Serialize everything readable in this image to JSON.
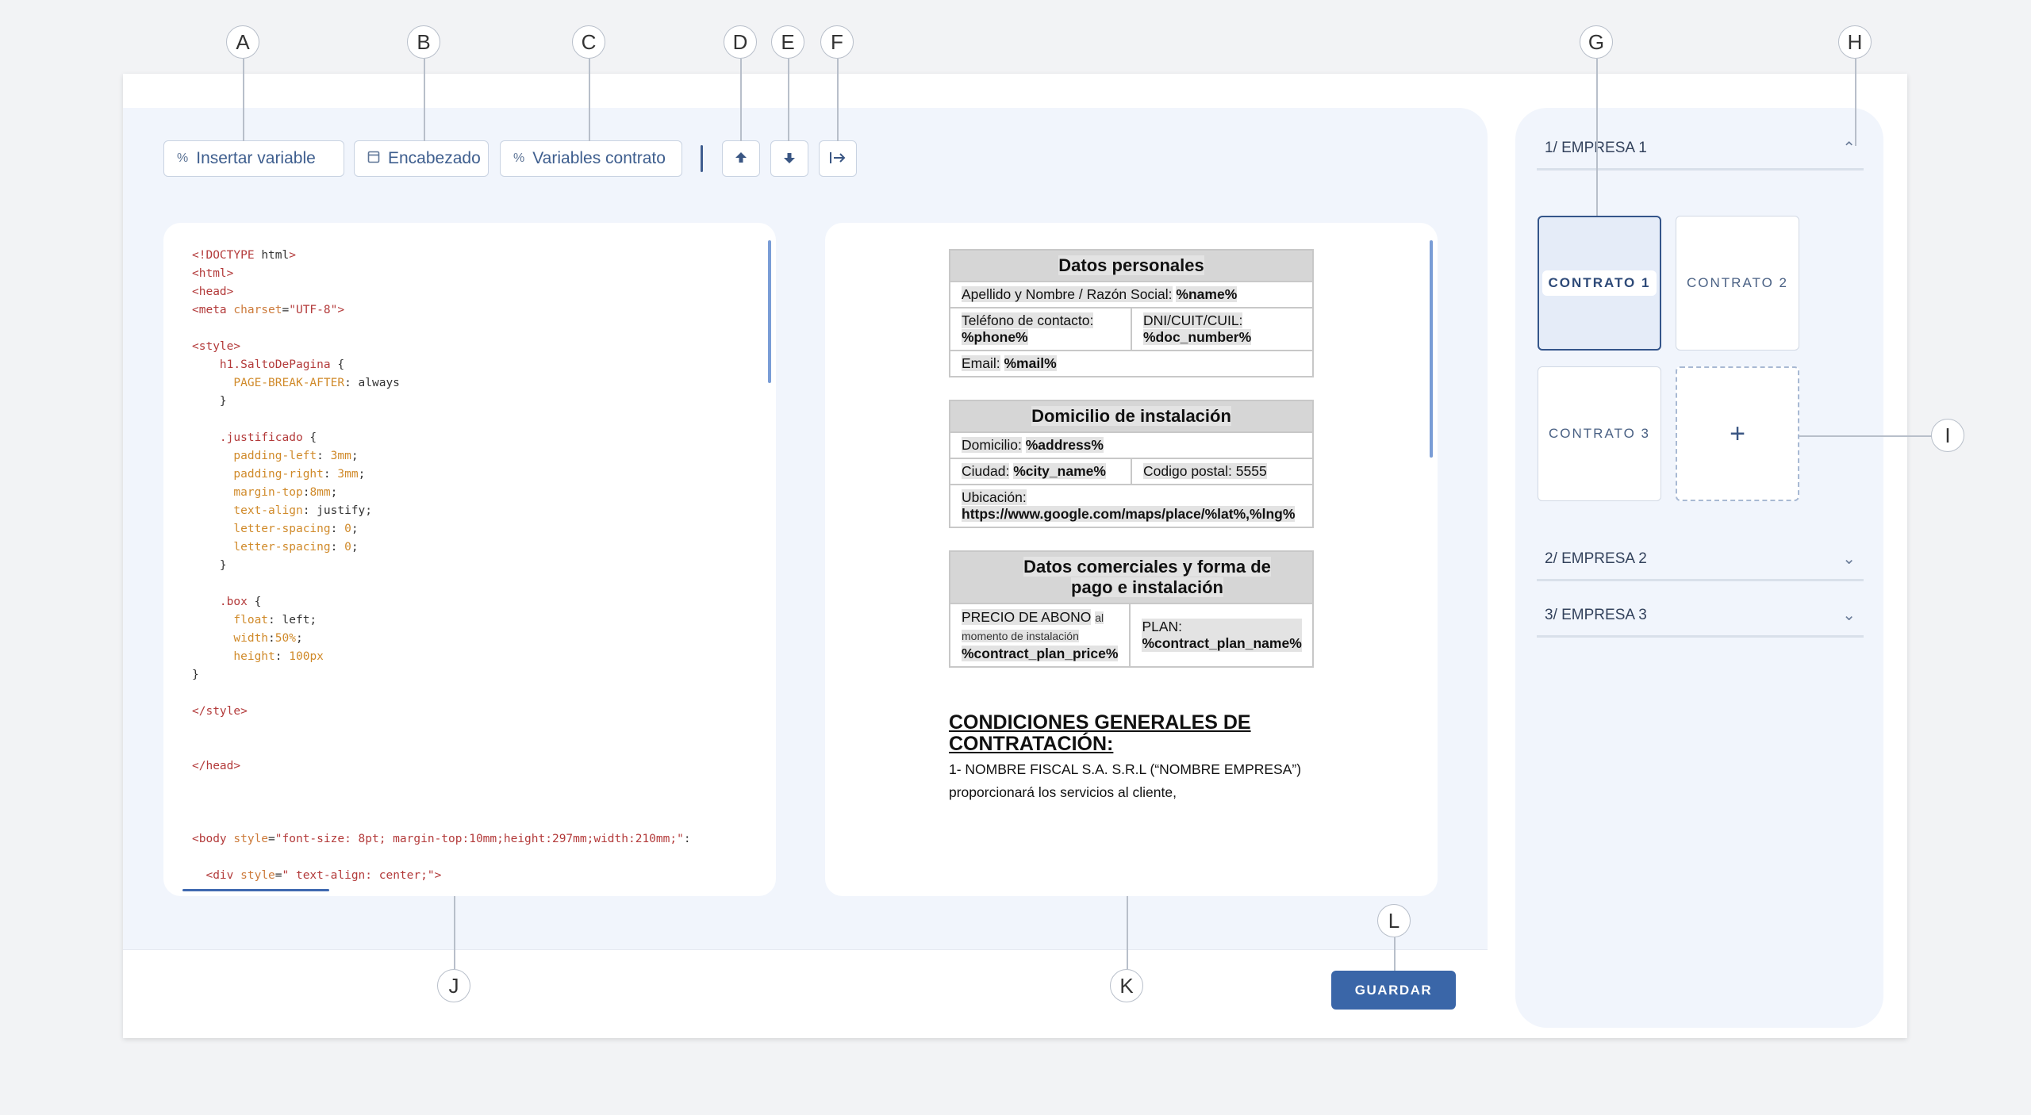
{
  "toolbar": {
    "insert_variable": "Insertar variable",
    "header": "Encabezado",
    "contract_variables": "Variables contrato"
  },
  "callouts": [
    "A",
    "B",
    "C",
    "D",
    "E",
    "F",
    "G",
    "H",
    "I",
    "J",
    "K",
    "L"
  ],
  "code": [
    [
      [
        "t-red",
        "<!DOCTYPE "
      ],
      [
        "t-dk",
        "html"
      ],
      [
        "t-red",
        ">"
      ]
    ],
    [
      [
        "t-red",
        "<html>"
      ]
    ],
    [
      [
        "t-red",
        "<head>"
      ]
    ],
    [
      [
        "t-red",
        "<meta "
      ],
      [
        "t-org",
        "charset"
      ],
      [
        "t-dk",
        "="
      ],
      [
        "t-str",
        "\"UTF-8\""
      ],
      [
        "t-red",
        ">"
      ]
    ],
    [],
    [
      [
        "t-red",
        "<style>"
      ]
    ],
    [
      [
        "t-dk",
        "    "
      ],
      [
        "t-red",
        "h1."
      ],
      [
        "t-red",
        "SaltoDePagina"
      ],
      [
        "t-dk",
        " {"
      ]
    ],
    [
      [
        "t-dk",
        "      "
      ],
      [
        "t-ylw",
        "PAGE-BREAK-AFTER"
      ],
      [
        "t-dk",
        ": always"
      ]
    ],
    [
      [
        "t-dk",
        "    }"
      ]
    ],
    [],
    [
      [
        "t-dk",
        "    "
      ],
      [
        "t-red",
        ".justificado"
      ],
      [
        "t-dk",
        " {"
      ]
    ],
    [
      [
        "t-dk",
        "      "
      ],
      [
        "t-ylw",
        "padding-left"
      ],
      [
        "t-dk",
        ": "
      ],
      [
        "t-ylw",
        "3mm"
      ],
      [
        "t-dk",
        ";"
      ]
    ],
    [
      [
        "t-dk",
        "      "
      ],
      [
        "t-ylw",
        "padding-right"
      ],
      [
        "t-dk",
        ": "
      ],
      [
        "t-ylw",
        "3mm"
      ],
      [
        "t-dk",
        ";"
      ]
    ],
    [
      [
        "t-dk",
        "      "
      ],
      [
        "t-ylw",
        "margin-top"
      ],
      [
        "t-dk",
        ":"
      ],
      [
        "t-ylw",
        "8mm"
      ],
      [
        "t-dk",
        ";"
      ]
    ],
    [
      [
        "t-dk",
        "      "
      ],
      [
        "t-ylw",
        "text-align"
      ],
      [
        "t-dk",
        ": justify;"
      ]
    ],
    [
      [
        "t-dk",
        "      "
      ],
      [
        "t-ylw",
        "letter-spacing"
      ],
      [
        "t-dk",
        ": "
      ],
      [
        "t-ylw",
        "0"
      ],
      [
        "t-dk",
        ";"
      ]
    ],
    [
      [
        "t-dk",
        "      "
      ],
      [
        "t-ylw",
        "letter-spacing"
      ],
      [
        "t-dk",
        ": "
      ],
      [
        "t-ylw",
        "0"
      ],
      [
        "t-dk",
        ";"
      ]
    ],
    [
      [
        "t-dk",
        "    }"
      ]
    ],
    [],
    [
      [
        "t-dk",
        "    "
      ],
      [
        "t-red",
        ".box"
      ],
      [
        "t-dk",
        " {"
      ]
    ],
    [
      [
        "t-dk",
        "      "
      ],
      [
        "t-ylw",
        "float"
      ],
      [
        "t-dk",
        ": left;"
      ]
    ],
    [
      [
        "t-dk",
        "      "
      ],
      [
        "t-ylw",
        "width"
      ],
      [
        "t-dk",
        ":"
      ],
      [
        "t-ylw",
        "50%"
      ],
      [
        "t-dk",
        ";"
      ]
    ],
    [
      [
        "t-dk",
        "      "
      ],
      [
        "t-ylw",
        "height"
      ],
      [
        "t-dk",
        ": "
      ],
      [
        "t-ylw",
        "100px"
      ]
    ],
    [
      [
        "t-dk",
        "}"
      ]
    ],
    [],
    [
      [
        "t-red",
        "</style>"
      ]
    ],
    [],
    [],
    [
      [
        "t-red",
        "</head>"
      ]
    ],
    [],
    [],
    [],
    [
      [
        "t-red",
        "<body "
      ],
      [
        "t-org",
        "style"
      ],
      [
        "t-dk",
        "="
      ],
      [
        "t-str",
        "\"font-size: 8pt; margin-top:10mm;height:297mm;width:210mm;\""
      ],
      [
        "t-dk",
        ":"
      ]
    ],
    [],
    [
      [
        "t-dk",
        "  "
      ],
      [
        "t-red",
        "<div "
      ],
      [
        "t-org",
        "style"
      ],
      [
        "t-dk",
        "="
      ],
      [
        "t-str",
        "\" text-align: center;\""
      ],
      [
        "t-red",
        ">"
      ]
    ]
  ],
  "preview": {
    "personal": {
      "title": "Datos personales",
      "name_label": "Apellido y Nombre / Razón Social:",
      "name_var": "%name%",
      "phone_label": "Teléfono de contacto:",
      "phone_var": "%phone%",
      "doc_label": "DNI/CUIT/CUIL:",
      "doc_var": "%doc_number%",
      "mail_label": "Email:",
      "mail_var": "%mail%"
    },
    "install": {
      "title": "Domicilio de instalación",
      "address_label": "Domicilio:",
      "address_var": "%address%",
      "city_label": "Ciudad:",
      "city_var": "%city_name%",
      "postal": "Codigo postal: 5555",
      "location_label": "Ubicación:",
      "location_var": "https://www.google.com/maps/place/%lat%,%lng%"
    },
    "commercial": {
      "title": "Datos comerciales y forma de pago e instalación",
      "price_label": "PRECIO DE ABONO",
      "price_small_1": "al",
      "price_small_2": "momento de instalación",
      "price_var": "%contract_plan_price%",
      "plan_label": "PLAN:",
      "plan_var": "%contract_plan_name%"
    },
    "conditions_title": "CONDICIONES GENERALES DE CONTRATACIÓN:",
    "conditions_p1": "1- NOMBRE FISCAL S.A. S.R.L (“NOMBRE EMPRESA”) proporcionará los servicios al cliente,"
  },
  "save_label": "GUARDAR",
  "side": {
    "companies": [
      "1/ EMPRESA 1",
      "2/ EMPRESA 2",
      "3/ EMPRESA 3"
    ],
    "contracts": [
      "CONTRATO 1",
      "CONTRATO 2",
      "CONTRATO 3"
    ],
    "add_label": "+"
  }
}
